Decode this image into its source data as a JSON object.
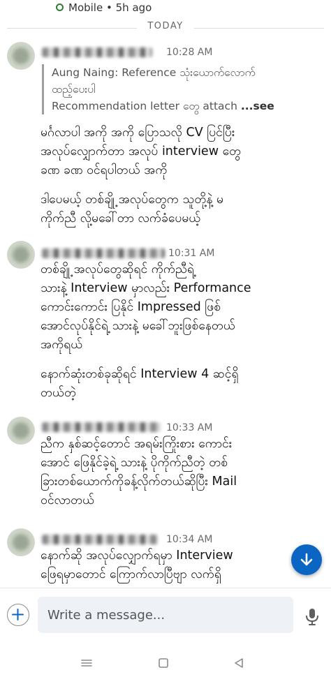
{
  "status": {
    "source": "Mobile",
    "separator": "•",
    "time": "5h ago",
    "status_color": "#2e7d32"
  },
  "divider": {
    "label": "TODAY"
  },
  "messages": [
    {
      "time": "10:28 AM",
      "quote_line1": "Aung Naing: Reference သုံးယောက်လောက်",
      "quote_line2": "ထည့်ပေးပါ",
      "quote_line3": "Recommendation letter တွေ attach",
      "quote_more": "...see",
      "p1_l1": "မင်္ဂလာပါ အကို အကို ပြောသလို CV ပြင်ပြီး",
      "p1_l2": "အလုပ်လျှောက်တာ အလုပ် interview တွေ",
      "p1_l3": "ခဏ ခဏ ဝင်ရပါတယ် အကို",
      "p2_l1": "ဒါပေမယ့် တစ်ချို့ အလုပ်တွေက သူတို့နဲ့ မ",
      "p2_l2": "ကိုက်ညီ လို့မခေါ်တာ လက်ခံပေမယ့်"
    },
    {
      "time": "10:31 AM",
      "p1_l1": "တစ်ချို့ အလုပ်တွေဆိုရင် ကိုက်ညီရဲ့",
      "p1_l2": "သားနဲ့ Interview မှာလည်း Performance",
      "p1_l3": "ကောင်းကောင်း ပြနိုင် Impressed ဖြစ်",
      "p1_l4": "အောင်လုပ်နိုင်ရဲ့ သားနဲ့ မခေါ်ဘူးဖြစ်နေတယ်",
      "p1_l5": "အကိုရယ်",
      "p2_l1": "နောက်ဆုံးတစ်ခုဆိုရင် Interview 4 ဆင့်ရှိ",
      "p2_l2": "တယ်တဲ့"
    },
    {
      "time": "10:33 AM",
      "p1_l1": "ညီက နှစ်ဆင့်တောင် အရမ်းကြိုးစား ကောင်း",
      "p1_l2": "အောင် ဖြေနိုင်ခဲ့ရဲ့ သားနဲ့ ပိုကိုက်ညီတဲ့ တစ်",
      "p1_l3": "ခြားတစ်ယောက်ကိုခန့်လိုက်တယ်ဆိုပြီး Mail",
      "p1_l4": "ဝင်လာတယ်"
    },
    {
      "time": "10:34 AM",
      "p1_l1": "နောက်ဆို အလုပ်လျှောက်ရမှာ Interview",
      "p1_l2": "ဖြေရမှာတောင် ကြောက်လာပြီဗျာ လက်ရှိ"
    }
  ],
  "composer": {
    "placeholder": "Write a message..."
  },
  "colors": {
    "accent": "#0a66c2",
    "input_bg": "#eef2f6",
    "quote_bar": "#9e9e9e"
  },
  "icons": {
    "status": "online-dot-icon",
    "fab": "arrow-down-icon",
    "attach": "plus-icon",
    "mic": "microphone-icon",
    "nav": [
      "menu-icon",
      "home-square-icon",
      "back-triangle-icon"
    ]
  }
}
